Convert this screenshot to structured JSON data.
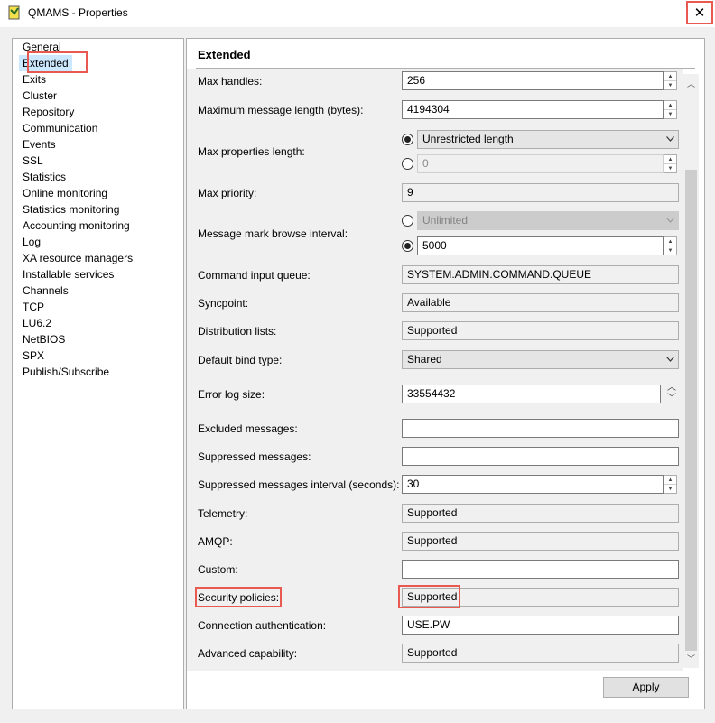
{
  "window": {
    "title": "QMAMS - Properties",
    "close_glyph": "✕"
  },
  "nav": {
    "items": [
      "General",
      "Extended",
      "Exits",
      "Cluster",
      "Repository",
      "Communication",
      "Events",
      "SSL",
      "Statistics",
      "Online monitoring",
      "Statistics monitoring",
      "Accounting monitoring",
      "Log",
      "XA resource managers",
      "Installable services",
      "Channels",
      "TCP",
      "LU6.2",
      "NetBIOS",
      "SPX",
      "Publish/Subscribe"
    ],
    "selected": "Extended"
  },
  "panel": {
    "title": "Extended",
    "fields": {
      "max_handles": {
        "label": "Max handles:",
        "value": "256"
      },
      "max_msg_len": {
        "label": "Maximum message length (bytes):",
        "value": "4194304"
      },
      "max_props": {
        "label": "Max properties length:",
        "option_selected": "Unrestricted length",
        "option_other_value": "0"
      },
      "max_priority": {
        "label": "Max priority:",
        "value": "9"
      },
      "msg_mark": {
        "label": "Message mark browse interval:",
        "option_unlimited": "Unlimited",
        "value": "5000"
      },
      "cmd_queue": {
        "label": "Command input queue:",
        "value": "SYSTEM.ADMIN.COMMAND.QUEUE"
      },
      "syncpoint": {
        "label": "Syncpoint:",
        "value": "Available"
      },
      "dist_lists": {
        "label": "Distribution lists:",
        "value": "Supported"
      },
      "bind_type": {
        "label": "Default bind type:",
        "value": "Shared"
      },
      "error_log": {
        "label": "Error log size:",
        "value": "33554432"
      },
      "excluded": {
        "label": "Excluded messages:",
        "value": ""
      },
      "suppressed": {
        "label": "Suppressed messages:",
        "value": ""
      },
      "suppressed_interval": {
        "label": "Suppressed messages interval (seconds):",
        "value": "30"
      },
      "telemetry": {
        "label": "Telemetry:",
        "value": "Supported"
      },
      "amqp": {
        "label": "AMQP:",
        "value": "Supported"
      },
      "custom": {
        "label": "Custom:",
        "value": ""
      },
      "security_policies": {
        "label": "Security policies:",
        "value": "Supported"
      },
      "conn_auth": {
        "label": "Connection authentication:",
        "value": "USE.PW"
      },
      "adv_capability": {
        "label": "Advanced capability:",
        "value": "Supported"
      }
    }
  },
  "buttons": {
    "apply": "Apply"
  },
  "colors": {
    "highlight": "#e8594f",
    "selection": "#cce8ff"
  }
}
